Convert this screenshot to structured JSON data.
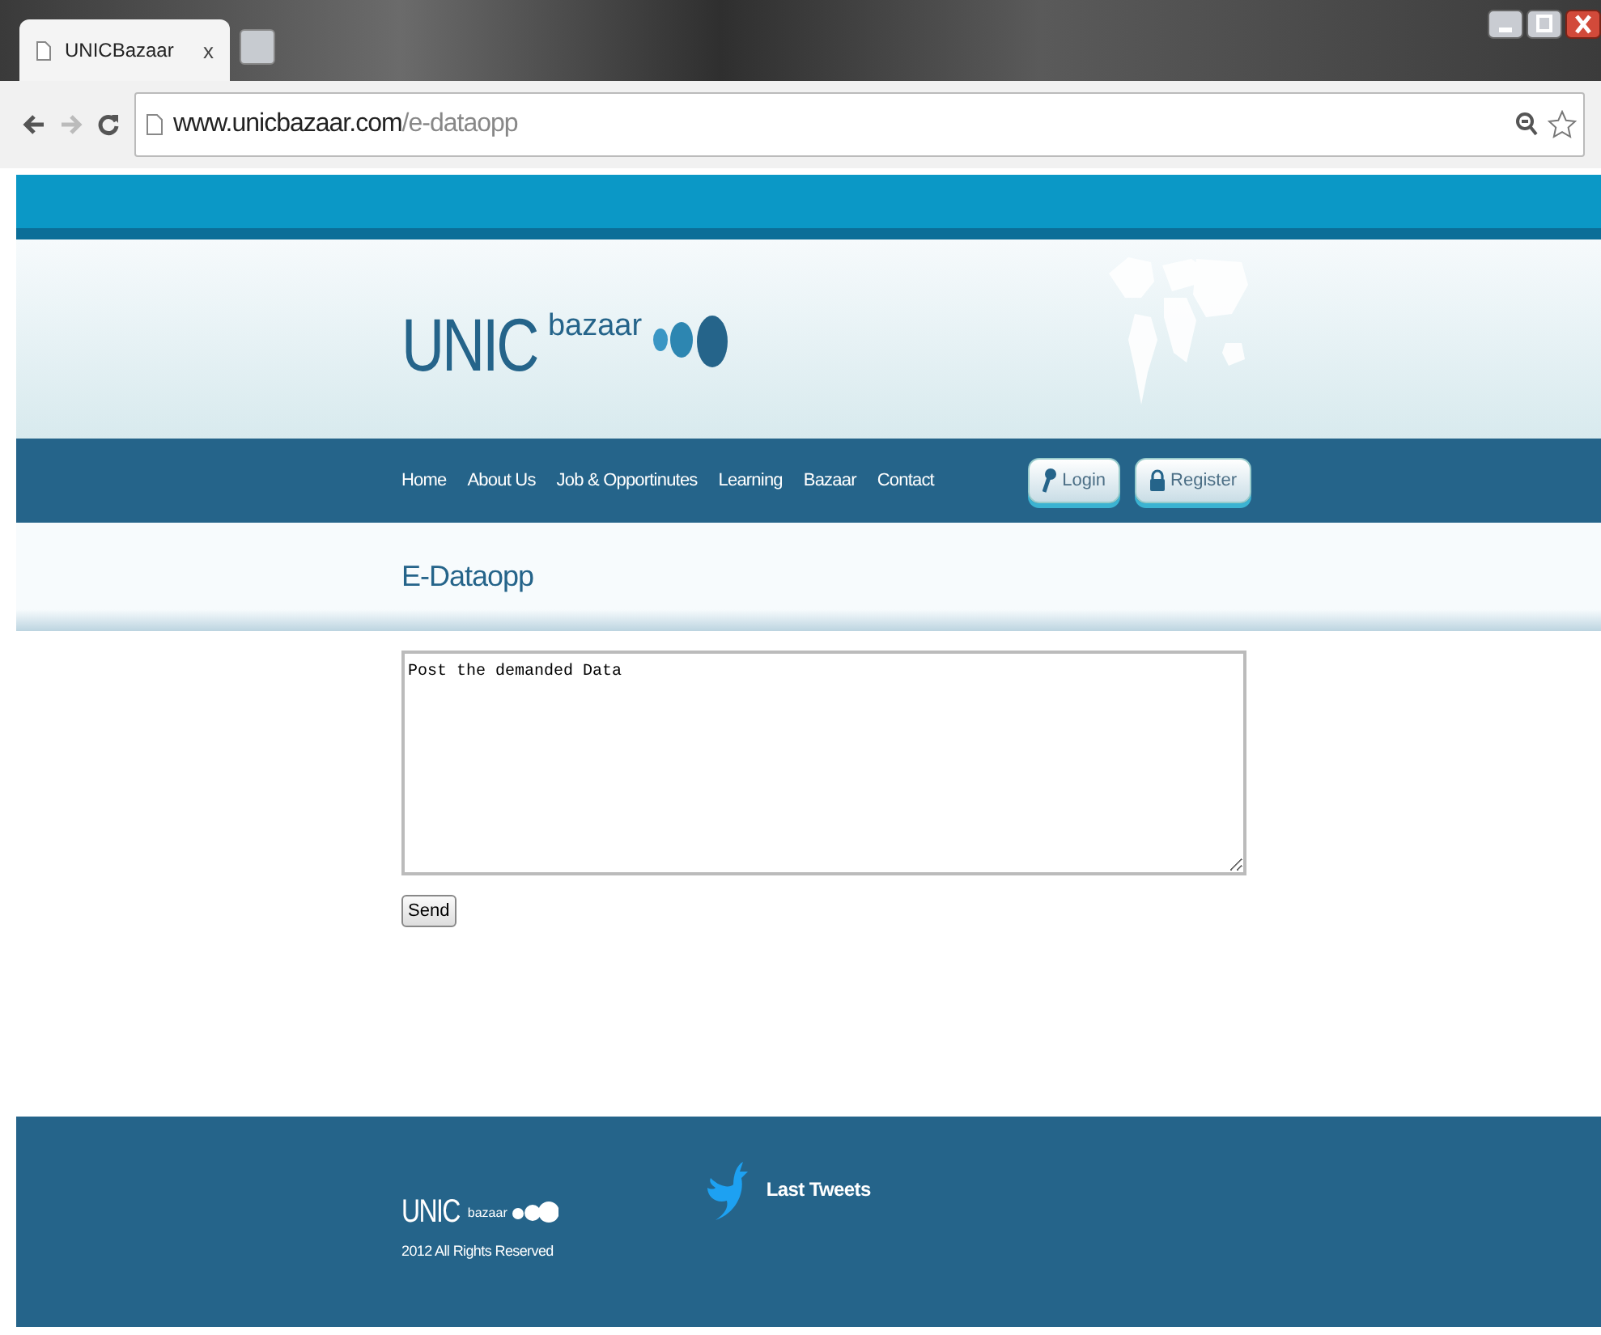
{
  "browser": {
    "tab_title": "UNICBazaar",
    "tab_close": "x",
    "url_host": "www.unicbazaar.com",
    "url_path": "/e-dataopp"
  },
  "header": {
    "logo_main": "UNIC",
    "logo_sub": "bazaar"
  },
  "nav": [
    {
      "label": "Home"
    },
    {
      "label": "About Us"
    },
    {
      "label": "Job & Opportinutes"
    },
    {
      "label": "Learning"
    },
    {
      "label": "Bazaar"
    },
    {
      "label": "Contact"
    }
  ],
  "account_buttons": [
    {
      "kind": "key",
      "label": "Login"
    },
    {
      "kind": "lock",
      "label": "Register"
    }
  ],
  "page_title": "E-Dataopp",
  "message": {
    "value": "Post the demanded Data "
  },
  "send_button": "Send",
  "footer": {
    "logo_main": "UNIC",
    "logo_sub": "bazaar",
    "copyright": "2012 All Rights Reserved",
    "tweets_title": "Last Tweets"
  }
}
